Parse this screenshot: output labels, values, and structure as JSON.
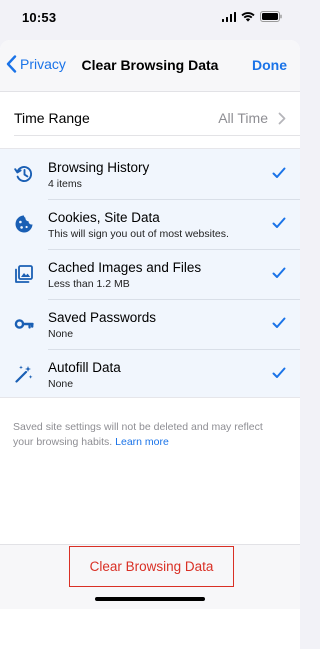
{
  "status_bar": {
    "time": "10:53",
    "icons": [
      "signal-icon",
      "wifi-icon",
      "battery-icon"
    ]
  },
  "nav": {
    "back_label": "Privacy",
    "title": "Clear Browsing Data",
    "done_label": "Done"
  },
  "time_range": {
    "label": "Time Range",
    "value": "All Time"
  },
  "data_types": [
    {
      "icon": "history-icon",
      "title": "Browsing History",
      "subtitle": "4 items",
      "checked": true
    },
    {
      "icon": "cookie-icon",
      "title": "Cookies, Site Data",
      "subtitle": "This will sign you out of most websites.",
      "checked": true
    },
    {
      "icon": "image-icon",
      "title": "Cached Images and Files",
      "subtitle": "Less than 1.2 MB",
      "checked": true
    },
    {
      "icon": "key-icon",
      "title": "Saved Passwords",
      "subtitle": "None",
      "checked": true
    },
    {
      "icon": "magic-wand-icon",
      "title": "Autofill Data",
      "subtitle": "None",
      "checked": true
    }
  ],
  "footnote": {
    "text": "Saved site settings will not be deleted and may reflect your browsing habits. ",
    "link": "Learn more"
  },
  "action": {
    "clear_label": "Clear Browsing Data"
  },
  "colors": {
    "accent": "#1a73e8",
    "destructive": "#d93025",
    "list_background": "#f1f6fd"
  }
}
